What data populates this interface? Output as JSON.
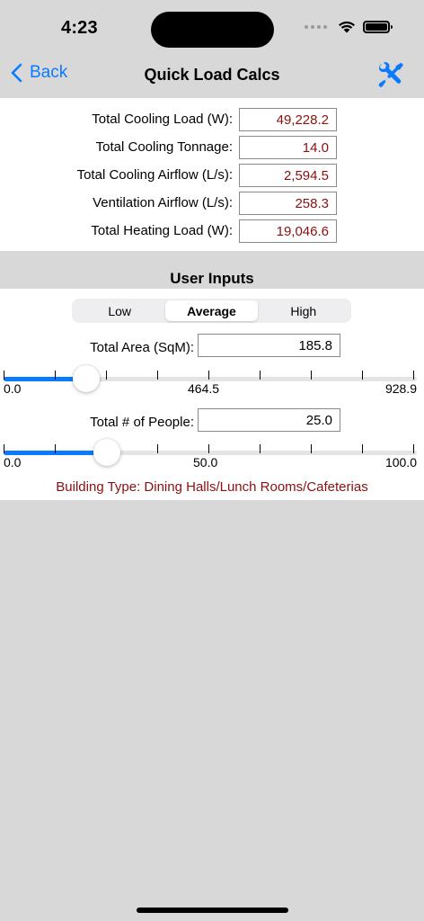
{
  "status_bar": {
    "time": "4:23",
    "icons": [
      "signal-dots-icon",
      "wifi-icon",
      "battery-icon"
    ]
  },
  "nav": {
    "back_label": "Back",
    "title": "Quick Load Calcs",
    "back_icon": "chevron-left-icon",
    "tools_icon": "wrench-screwdriver-icon"
  },
  "results": [
    {
      "label": "Total Cooling Load (W):",
      "value": "49,228.2"
    },
    {
      "label": "Total Cooling Tonnage:",
      "value": "14.0"
    },
    {
      "label": "Total Cooling Airflow (L/s):",
      "value": "2,594.5"
    },
    {
      "label": "Ventilation Airflow (L/s):",
      "value": "258.3"
    },
    {
      "label": "Total Heating Load (W):",
      "value": "19,046.6"
    }
  ],
  "user_inputs": {
    "title": "User Inputs",
    "segments": [
      "Low",
      "Average",
      "High"
    ],
    "selected_segment": "Average",
    "area": {
      "label": "Total Area (SqM):",
      "value": "185.8",
      "slider": {
        "min": 0.0,
        "max": 928.9,
        "value": 185.8,
        "min_label": "0.0",
        "mid_label": "464.5",
        "max_label": "928.9"
      }
    },
    "people": {
      "label": "Total # of People:",
      "value": "25.0",
      "slider": {
        "min": 0.0,
        "max": 100.0,
        "value": 25.0,
        "min_label": "0.0",
        "mid_label": "50.0",
        "max_label": "100.0"
      }
    },
    "building_type": "Building Type: Dining Halls/Lunch Rooms/Cafeterias"
  },
  "colors": {
    "accent": "#0a7aff",
    "result_text": "#8a1010",
    "background": "#d8d8d8"
  }
}
